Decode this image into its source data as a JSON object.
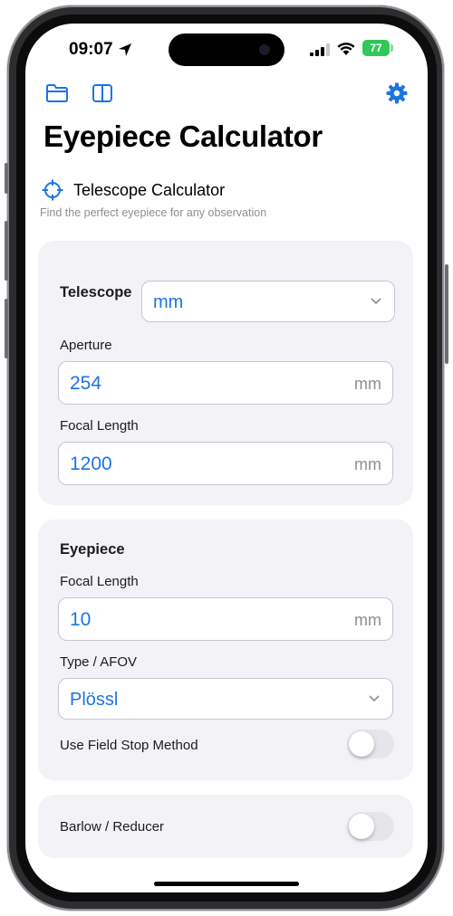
{
  "status": {
    "time": "09:07",
    "battery": "77"
  },
  "toolbar": {
    "folder": "folder-icon",
    "sidebar": "sidebar-icon",
    "settings": "gear-icon"
  },
  "page": {
    "title": "Eyepiece Calculator"
  },
  "section": {
    "title": "Telescope Calculator",
    "subtitle": "Find the perfect eyepiece for any observation"
  },
  "telescope": {
    "heading": "Telescope",
    "unit_select": "mm",
    "aperture_label": "Aperture",
    "aperture_value": "254",
    "aperture_unit": "mm",
    "focal_label": "Focal Length",
    "focal_value": "1200",
    "focal_unit": "mm"
  },
  "eyepiece": {
    "heading": "Eyepiece",
    "focal_label": "Focal Length",
    "focal_value": "10",
    "focal_unit": "mm",
    "type_label": "Type / AFOV",
    "type_value": "Plössl",
    "field_stop_label": "Use Field Stop Method",
    "field_stop_on": false
  },
  "barlow": {
    "label": "Barlow / Reducer",
    "on": false
  },
  "colors": {
    "accent": "#1d74e3",
    "card": "#f2f2f7",
    "battery": "#32c759"
  }
}
